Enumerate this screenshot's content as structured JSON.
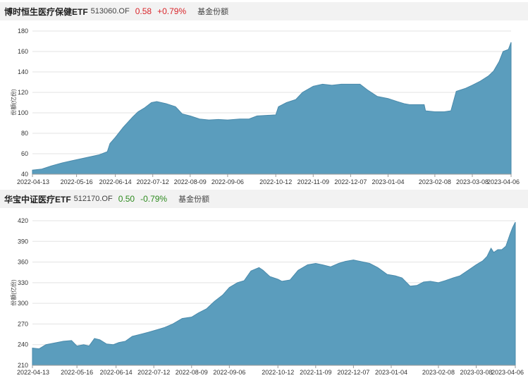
{
  "panels": [
    {
      "name": "博时恒生医疗保健ETF",
      "code": "513060.OF",
      "price": "0.58",
      "change": "+0.79%",
      "metric_label": "基金份额",
      "direction": "up"
    },
    {
      "name": "华宝中证医疗ETF",
      "code": "512170.OF",
      "price": "0.50",
      "change": "-0.79%",
      "metric_label": "基金份额",
      "direction": "down"
    }
  ],
  "colors": {
    "area_fill": "#5b9dbd",
    "area_stroke": "#4a8aab",
    "up": "#d9262b",
    "down": "#2e8b1f"
  },
  "chart_data": [
    {
      "type": "area",
      "ylabel": "份额(亿份)",
      "ylim": [
        40,
        180
      ],
      "yticks": [
        40,
        60,
        80,
        100,
        120,
        140,
        160,
        180
      ],
      "xlim": [
        "2022-04-13",
        "2023-04-06"
      ],
      "x_ticks": [
        "2022-04-13",
        "2022-05-16",
        "2022-06-14",
        "2022-07-12",
        "2022-08-09",
        "2022-09-06",
        "2022-10-12",
        "2022-11-09",
        "2022-12-07",
        "2023-01-04",
        "2023-02-08",
        "2023-03-08",
        "2023-04-06"
      ],
      "grid": true,
      "points": [
        [
          "2022-04-13",
          44
        ],
        [
          "2022-04-20",
          45
        ],
        [
          "2022-04-27",
          48
        ],
        [
          "2022-05-05",
          51
        ],
        [
          "2022-05-12",
          53
        ],
        [
          "2022-05-19",
          55
        ],
        [
          "2022-05-26",
          57
        ],
        [
          "2022-06-02",
          59
        ],
        [
          "2022-06-08",
          62
        ],
        [
          "2022-06-10",
          70
        ],
        [
          "2022-06-14",
          76
        ],
        [
          "2022-06-20",
          86
        ],
        [
          "2022-06-27",
          96
        ],
        [
          "2022-07-01",
          101
        ],
        [
          "2022-07-06",
          105
        ],
        [
          "2022-07-11",
          110
        ],
        [
          "2022-07-15",
          111
        ],
        [
          "2022-07-22",
          109
        ],
        [
          "2022-07-29",
          106
        ],
        [
          "2022-08-03",
          99
        ],
        [
          "2022-08-09",
          97
        ],
        [
          "2022-08-16",
          94
        ],
        [
          "2022-08-23",
          93
        ],
        [
          "2022-08-30",
          93.5
        ],
        [
          "2022-09-06",
          93
        ],
        [
          "2022-09-15",
          94
        ],
        [
          "2022-09-22",
          94
        ],
        [
          "2022-09-28",
          97
        ],
        [
          "2022-10-12",
          98
        ],
        [
          "2022-10-14",
          106
        ],
        [
          "2022-10-20",
          110
        ],
        [
          "2022-10-27",
          113
        ],
        [
          "2022-11-01",
          120
        ],
        [
          "2022-11-09",
          126
        ],
        [
          "2022-11-16",
          128
        ],
        [
          "2022-11-23",
          127
        ],
        [
          "2022-11-30",
          128
        ],
        [
          "2022-12-07",
          128
        ],
        [
          "2022-12-14",
          128
        ],
        [
          "2022-12-20",
          122
        ],
        [
          "2022-12-27",
          116
        ],
        [
          "2023-01-04",
          114
        ],
        [
          "2023-01-11",
          111
        ],
        [
          "2023-01-16",
          109
        ],
        [
          "2023-01-20",
          108
        ],
        [
          "2023-01-31",
          108
        ],
        [
          "2023-02-01",
          102
        ],
        [
          "2023-02-08",
          101
        ],
        [
          "2023-02-15",
          101
        ],
        [
          "2023-02-20",
          102
        ],
        [
          "2023-02-24",
          121
        ],
        [
          "2023-03-03",
          124
        ],
        [
          "2023-03-08",
          127
        ],
        [
          "2023-03-14",
          131
        ],
        [
          "2023-03-20",
          136
        ],
        [
          "2023-03-24",
          141
        ],
        [
          "2023-03-28",
          150
        ],
        [
          "2023-03-31",
          160
        ],
        [
          "2023-04-04",
          162
        ],
        [
          "2023-04-06",
          169
        ]
      ]
    },
    {
      "type": "area",
      "ylabel": "份额(亿份)",
      "ylim": [
        210,
        420
      ],
      "yticks": [
        210,
        240,
        270,
        300,
        330,
        360,
        390,
        420
      ],
      "xlim": [
        "2022-04-13",
        "2023-04-06"
      ],
      "x_ticks": [
        "2022-04-13",
        "2022-05-16",
        "2022-06-14",
        "2022-07-12",
        "2022-08-09",
        "2022-09-06",
        "2022-10-12",
        "2022-11-09",
        "2022-12-07",
        "2023-01-04",
        "2023-02-08",
        "2023-03-08",
        "2023-04-06"
      ],
      "grid": true,
      "points": [
        [
          "2022-04-13",
          235
        ],
        [
          "2022-04-18",
          234
        ],
        [
          "2022-04-23",
          240
        ],
        [
          "2022-05-01",
          243
        ],
        [
          "2022-05-06",
          245
        ],
        [
          "2022-05-12",
          246
        ],
        [
          "2022-05-16",
          238
        ],
        [
          "2022-05-21",
          240
        ],
        [
          "2022-05-25",
          238
        ],
        [
          "2022-05-29",
          249
        ],
        [
          "2022-06-02",
          247
        ],
        [
          "2022-06-07",
          241
        ],
        [
          "2022-06-12",
          240
        ],
        [
          "2022-06-16",
          243
        ],
        [
          "2022-06-21",
          245
        ],
        [
          "2022-06-26",
          252
        ],
        [
          "2022-07-02",
          255
        ],
        [
          "2022-07-08",
          258
        ],
        [
          "2022-07-15",
          262
        ],
        [
          "2022-07-20",
          265
        ],
        [
          "2022-07-26",
          270
        ],
        [
          "2022-08-02",
          278
        ],
        [
          "2022-08-09",
          280
        ],
        [
          "2022-08-14",
          286
        ],
        [
          "2022-08-20",
          292
        ],
        [
          "2022-08-26",
          303
        ],
        [
          "2022-09-01",
          312
        ],
        [
          "2022-09-06",
          323
        ],
        [
          "2022-09-12",
          330
        ],
        [
          "2022-09-17",
          333
        ],
        [
          "2022-09-22",
          347
        ],
        [
          "2022-09-28",
          352
        ],
        [
          "2022-10-01",
          348
        ],
        [
          "2022-10-06",
          339
        ],
        [
          "2022-10-12",
          335
        ],
        [
          "2022-10-15",
          332
        ],
        [
          "2022-10-21",
          334
        ],
        [
          "2022-10-27",
          348
        ],
        [
          "2022-11-03",
          356
        ],
        [
          "2022-11-09",
          358
        ],
        [
          "2022-11-14",
          356
        ],
        [
          "2022-11-20",
          353
        ],
        [
          "2022-11-26",
          358
        ],
        [
          "2022-12-01",
          361
        ],
        [
          "2022-12-07",
          363
        ],
        [
          "2022-12-12",
          361
        ],
        [
          "2022-12-19",
          358
        ],
        [
          "2022-12-25",
          352
        ],
        [
          "2023-01-01",
          342
        ],
        [
          "2023-01-07",
          340
        ],
        [
          "2023-01-12",
          337
        ],
        [
          "2023-01-18",
          325
        ],
        [
          "2023-01-23",
          326
        ],
        [
          "2023-01-28",
          331
        ],
        [
          "2023-02-02",
          332
        ],
        [
          "2023-02-08",
          330
        ],
        [
          "2023-02-13",
          333
        ],
        [
          "2023-02-19",
          337
        ],
        [
          "2023-02-24",
          340
        ],
        [
          "2023-03-02",
          348
        ],
        [
          "2023-03-08",
          356
        ],
        [
          "2023-03-13",
          362
        ],
        [
          "2023-03-16",
          368
        ],
        [
          "2023-03-19",
          380
        ],
        [
          "2023-03-21",
          374
        ],
        [
          "2023-03-24",
          378
        ],
        [
          "2023-03-27",
          378
        ],
        [
          "2023-03-30",
          383
        ],
        [
          "2023-04-02",
          400
        ],
        [
          "2023-04-04",
          410
        ],
        [
          "2023-04-06",
          418
        ]
      ]
    }
  ]
}
